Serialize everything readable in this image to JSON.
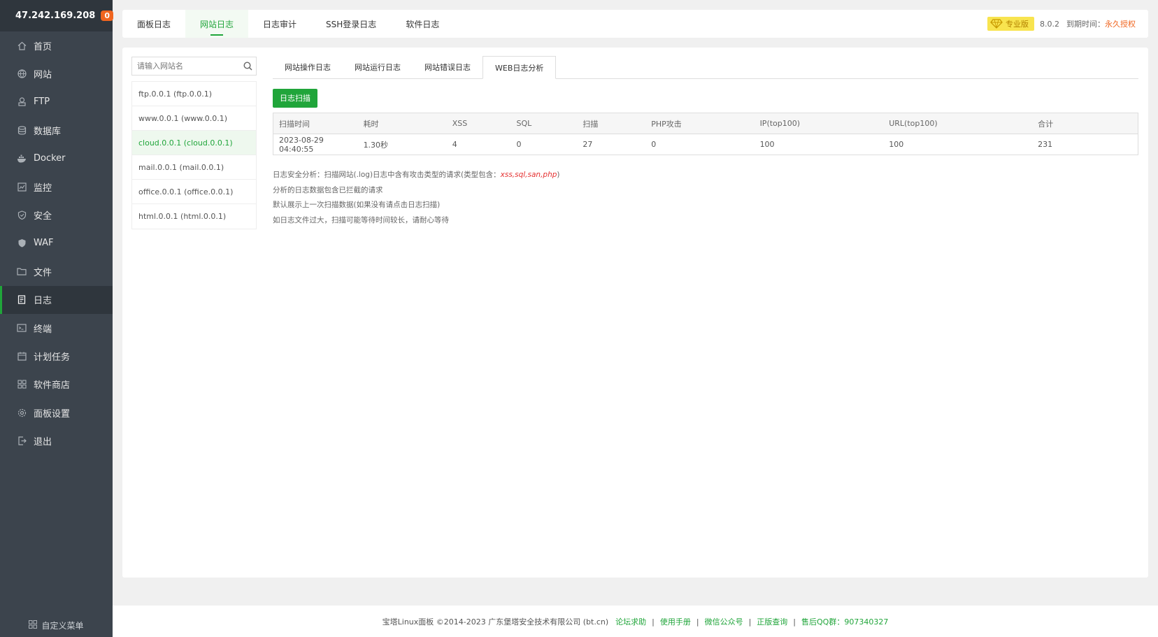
{
  "server": {
    "ip": "47.242.169.208",
    "badge": "0"
  },
  "sidebar": {
    "items": [
      {
        "label": "首页",
        "icon": "home-icon"
      },
      {
        "label": "网站",
        "icon": "globe-icon"
      },
      {
        "label": "FTP",
        "icon": "ftp-icon"
      },
      {
        "label": "数据库",
        "icon": "database-icon"
      },
      {
        "label": "Docker",
        "icon": "docker-icon"
      },
      {
        "label": "监控",
        "icon": "monitor-icon"
      },
      {
        "label": "安全",
        "icon": "shield-icon"
      },
      {
        "label": "WAF",
        "icon": "waf-icon"
      },
      {
        "label": "文件",
        "icon": "folder-icon"
      },
      {
        "label": "日志",
        "icon": "log-icon"
      },
      {
        "label": "终端",
        "icon": "terminal-icon"
      },
      {
        "label": "计划任务",
        "icon": "calendar-icon"
      },
      {
        "label": "软件商店",
        "icon": "apps-icon"
      },
      {
        "label": "面板设置",
        "icon": "gear-icon"
      },
      {
        "label": "退出",
        "icon": "logout-icon"
      }
    ],
    "active_index": 9,
    "custom_menu": "自定义菜单"
  },
  "topnav": {
    "tabs": [
      "面板日志",
      "网站日志",
      "日志审计",
      "SSH登录日志",
      "软件日志"
    ],
    "active_index": 1,
    "edition": "专业版",
    "version": "8.0.2",
    "expire_label": "到期时间：",
    "expire_value": "永久授权"
  },
  "site_panel": {
    "search_placeholder": "请输入网站名",
    "sites": [
      "ftp.0.0.1  (ftp.0.0.1)",
      "www.0.0.1  (www.0.0.1)",
      "cloud.0.0.1  (cloud.0.0.1)",
      "mail.0.0.1  (mail.0.0.1)",
      "office.0.0.1  (office.0.0.1)",
      "html.0.0.1  (html.0.0.1)"
    ],
    "active_index": 2
  },
  "content": {
    "tabs": [
      "网站操作日志",
      "网站运行日志",
      "网站错误日志",
      "WEB日志分析"
    ],
    "active_index": 3,
    "scan_button": "日志扫描",
    "table": {
      "headers": [
        "扫描时间",
        "耗时",
        "XSS",
        "SQL",
        "扫描",
        "PHP攻击",
        "IP(top100)",
        "URL(top100)",
        "合计"
      ],
      "row": [
        "2023-08-29 04:40:55",
        "1.30秒",
        "4",
        "0",
        "27",
        "0",
        "100",
        "100",
        "231"
      ]
    },
    "notes": {
      "line1_prefix": "日志安全分析：扫描网站(.log)日志中含有攻击类型的请求(类型包含：",
      "line1_types": "xss,sql,san,php",
      "line1_suffix": ")",
      "line2": "分析的日志数据包含已拦截的请求",
      "line3": "默认展示上一次扫描数据(如果没有请点击日志扫描)",
      "line4": "如日志文件过大，扫描可能等待时间较长，请耐心等待"
    }
  },
  "footer": {
    "copyright": "宝塔Linux面板 ©2014-2023 广东堡塔安全技术有限公司 (bt.cn)",
    "links": [
      "论坛求助",
      "使用手册",
      "微信公众号",
      "正版查询",
      "售后QQ群：907340327"
    ]
  },
  "colors": {
    "accent": "#20a53a",
    "sidebar_bg": "#3c444d",
    "danger": "#e53030",
    "warn": "#f0651f"
  }
}
